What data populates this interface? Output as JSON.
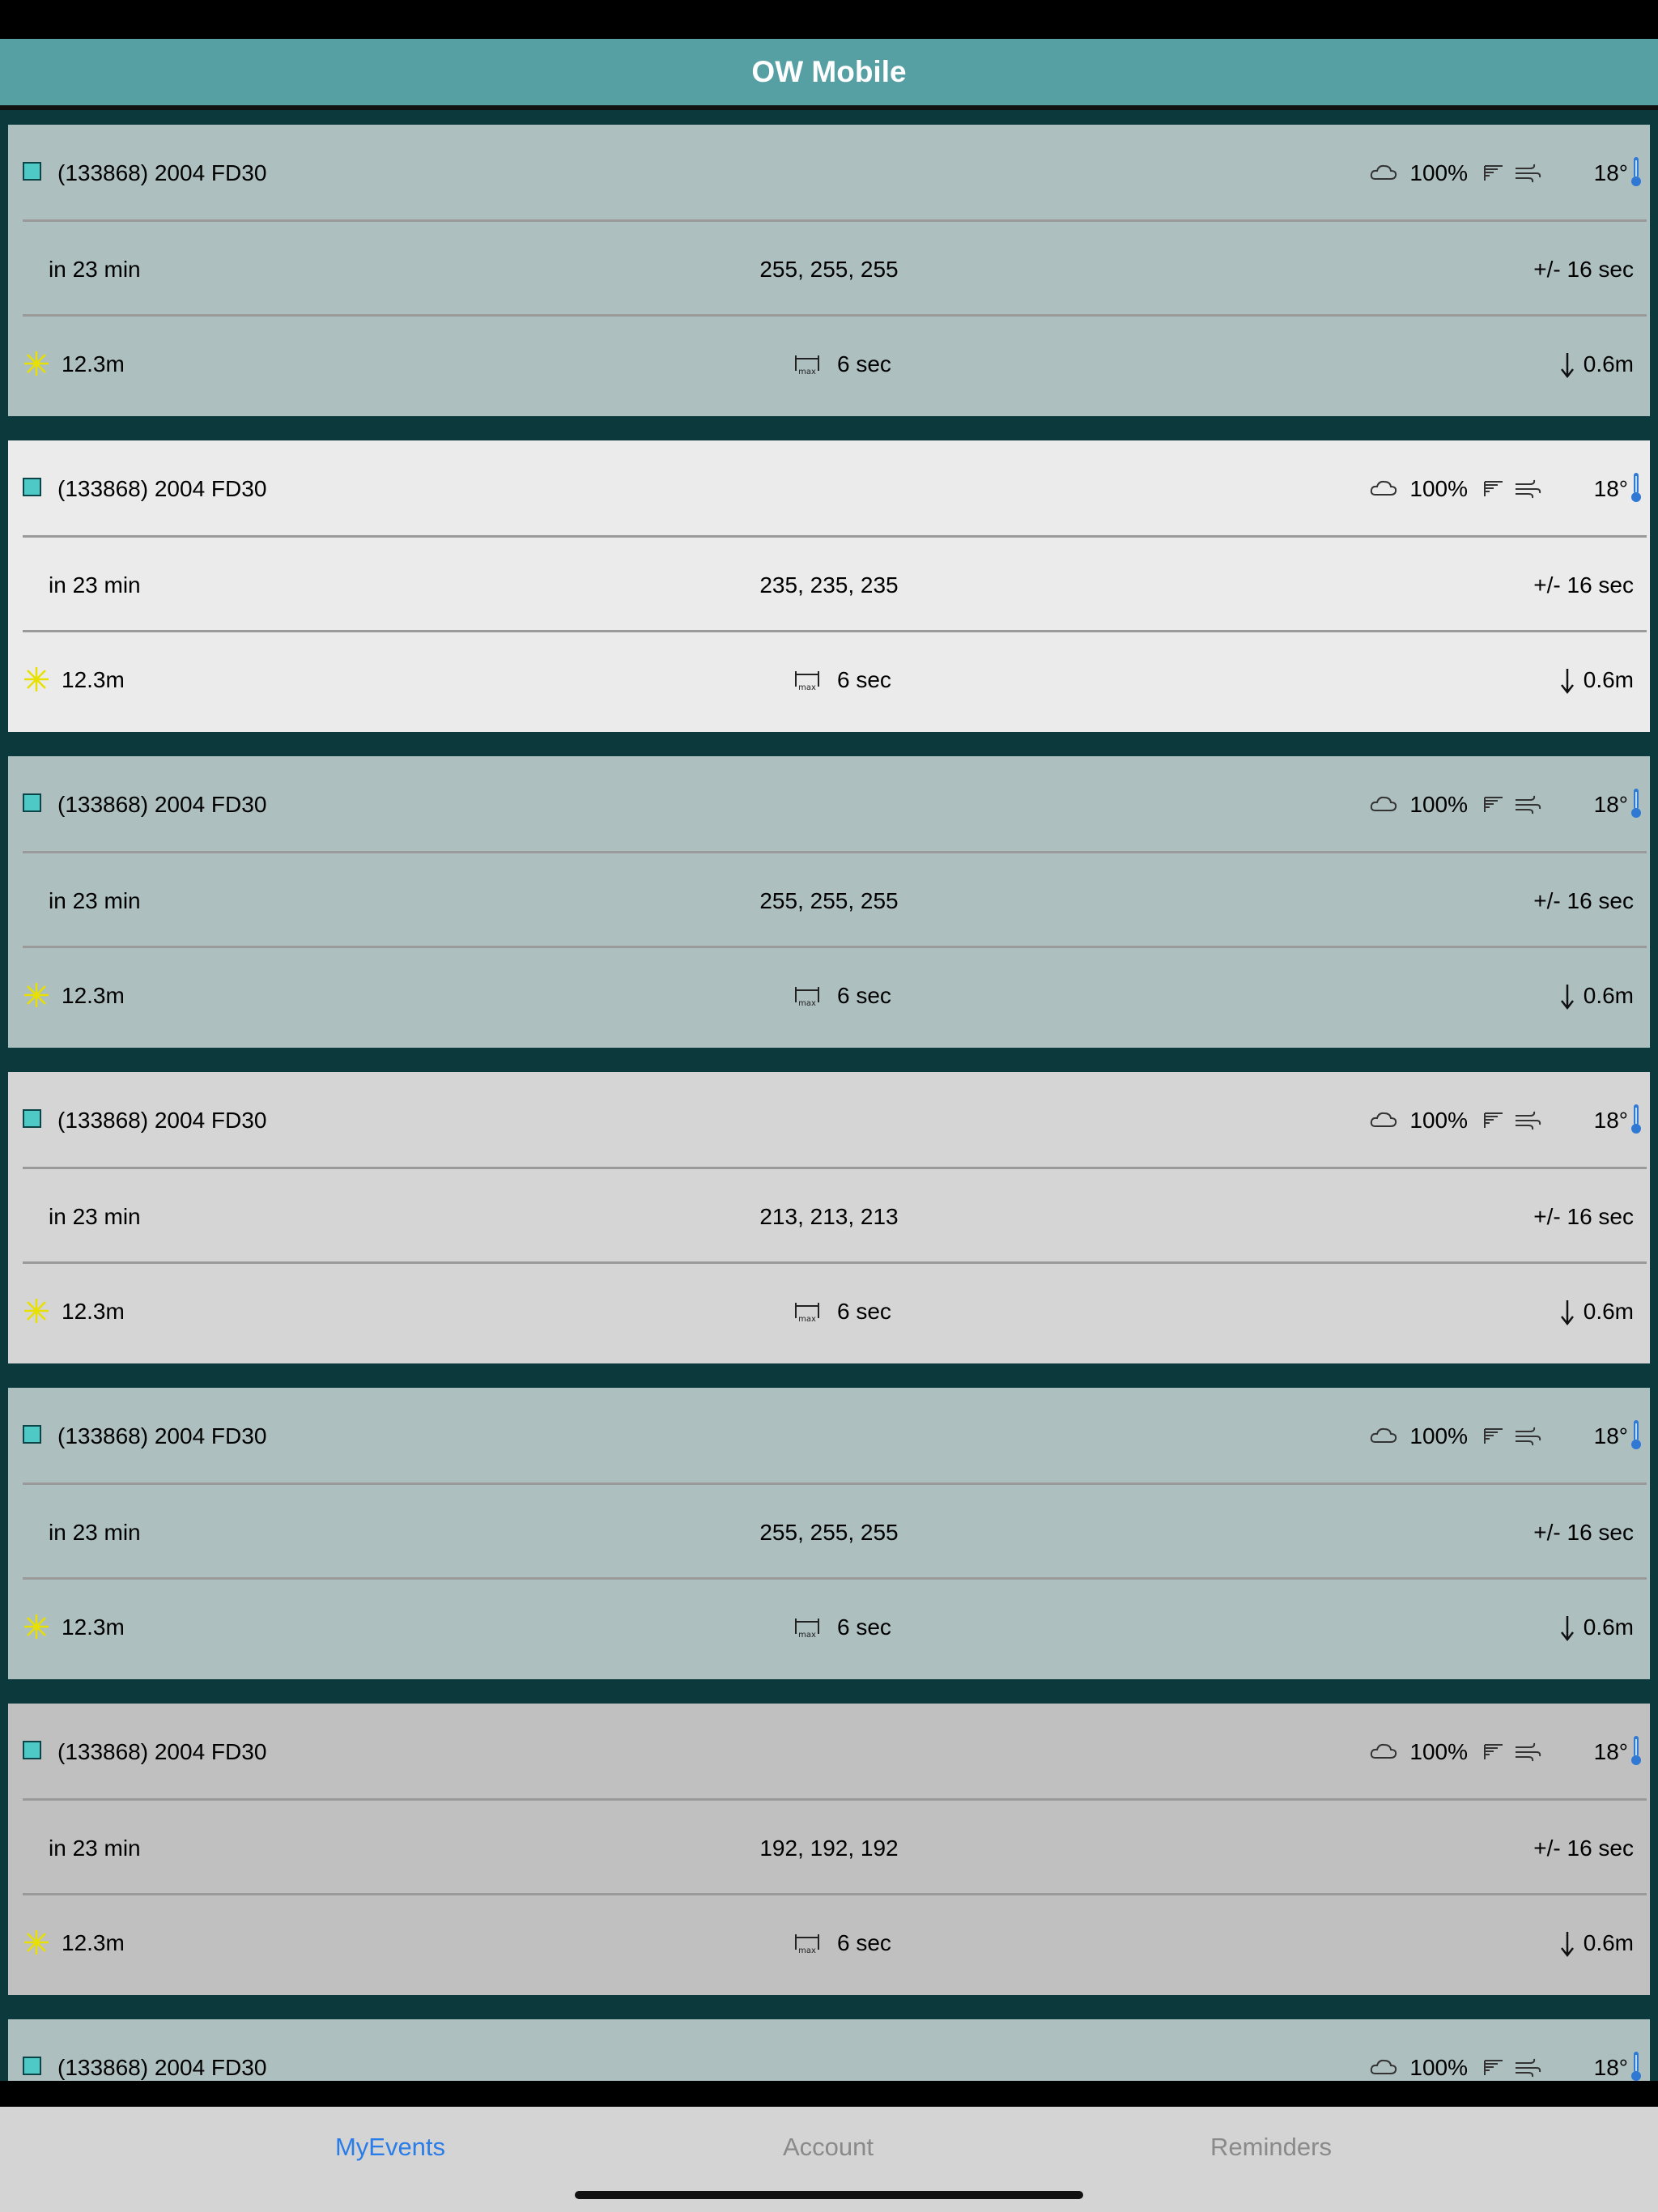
{
  "app": {
    "title": "OW Mobile"
  },
  "events": [
    {
      "name": "(133868) 2004 FD30",
      "cloud_pct": "100%",
      "temp": "18°",
      "time_until": "in 23 min",
      "color": "255, 255, 255",
      "uncertainty": "+/- 16 sec",
      "magnitude": "12.3m",
      "max_duration": "6 sec",
      "drop": "0.6m",
      "bg": "#adbfbf"
    },
    {
      "name": "(133868) 2004 FD30",
      "cloud_pct": "100%",
      "temp": "18°",
      "time_until": "in 23 min",
      "color": "235, 235, 235",
      "uncertainty": "+/- 16 sec",
      "magnitude": "12.3m",
      "max_duration": "6 sec",
      "drop": "0.6m",
      "bg": "#ebebeb"
    },
    {
      "name": "(133868) 2004 FD30",
      "cloud_pct": "100%",
      "temp": "18°",
      "time_until": "in 23 min",
      "color": "255, 255, 255",
      "uncertainty": "+/- 16 sec",
      "magnitude": "12.3m",
      "max_duration": "6 sec",
      "drop": "0.6m",
      "bg": "#adbfbf"
    },
    {
      "name": "(133868) 2004 FD30",
      "cloud_pct": "100%",
      "temp": "18°",
      "time_until": "in 23 min",
      "color": "213, 213, 213",
      "uncertainty": "+/- 16 sec",
      "magnitude": "12.3m",
      "max_duration": "6 sec",
      "drop": "0.6m",
      "bg": "#d5d5d5"
    },
    {
      "name": "(133868) 2004 FD30",
      "cloud_pct": "100%",
      "temp": "18°",
      "time_until": "in 23 min",
      "color": "255, 255, 255",
      "uncertainty": "+/- 16 sec",
      "magnitude": "12.3m",
      "max_duration": "6 sec",
      "drop": "0.6m",
      "bg": "#adbfbf"
    },
    {
      "name": "(133868) 2004 FD30",
      "cloud_pct": "100%",
      "temp": "18°",
      "time_until": "in 23 min",
      "color": "192, 192, 192",
      "uncertainty": "+/- 16 sec",
      "magnitude": "12.3m",
      "max_duration": "6 sec",
      "drop": "0.6m",
      "bg": "#c0c0c0"
    },
    {
      "name": "(133868) 2004 FD30",
      "cloud_pct": "100%",
      "temp": "18°",
      "time_until": "",
      "color": "",
      "uncertainty": "",
      "magnitude": "",
      "max_duration": "",
      "drop": "",
      "bg": "#adbfbf"
    }
  ],
  "icons": {
    "event_marker": "square-icon",
    "cloud": "cloud-icon",
    "rain": "rain-icon",
    "wind": "wind-icon",
    "temperature": "thermometer-icon",
    "star": "star-icon",
    "max_duration": "max-duration-icon",
    "drop": "arrow-down-icon"
  },
  "colors": {
    "nav": "#56a0a4",
    "list_bg": "#0c3a3c",
    "marker": "#4ec9c6",
    "tab_active": "#2a7de8",
    "tab_inactive": "#8a8a8a"
  },
  "tabs": [
    {
      "label": "MyEvents",
      "active": true
    },
    {
      "label": "Account",
      "active": false
    },
    {
      "label": "Reminders",
      "active": false
    }
  ]
}
